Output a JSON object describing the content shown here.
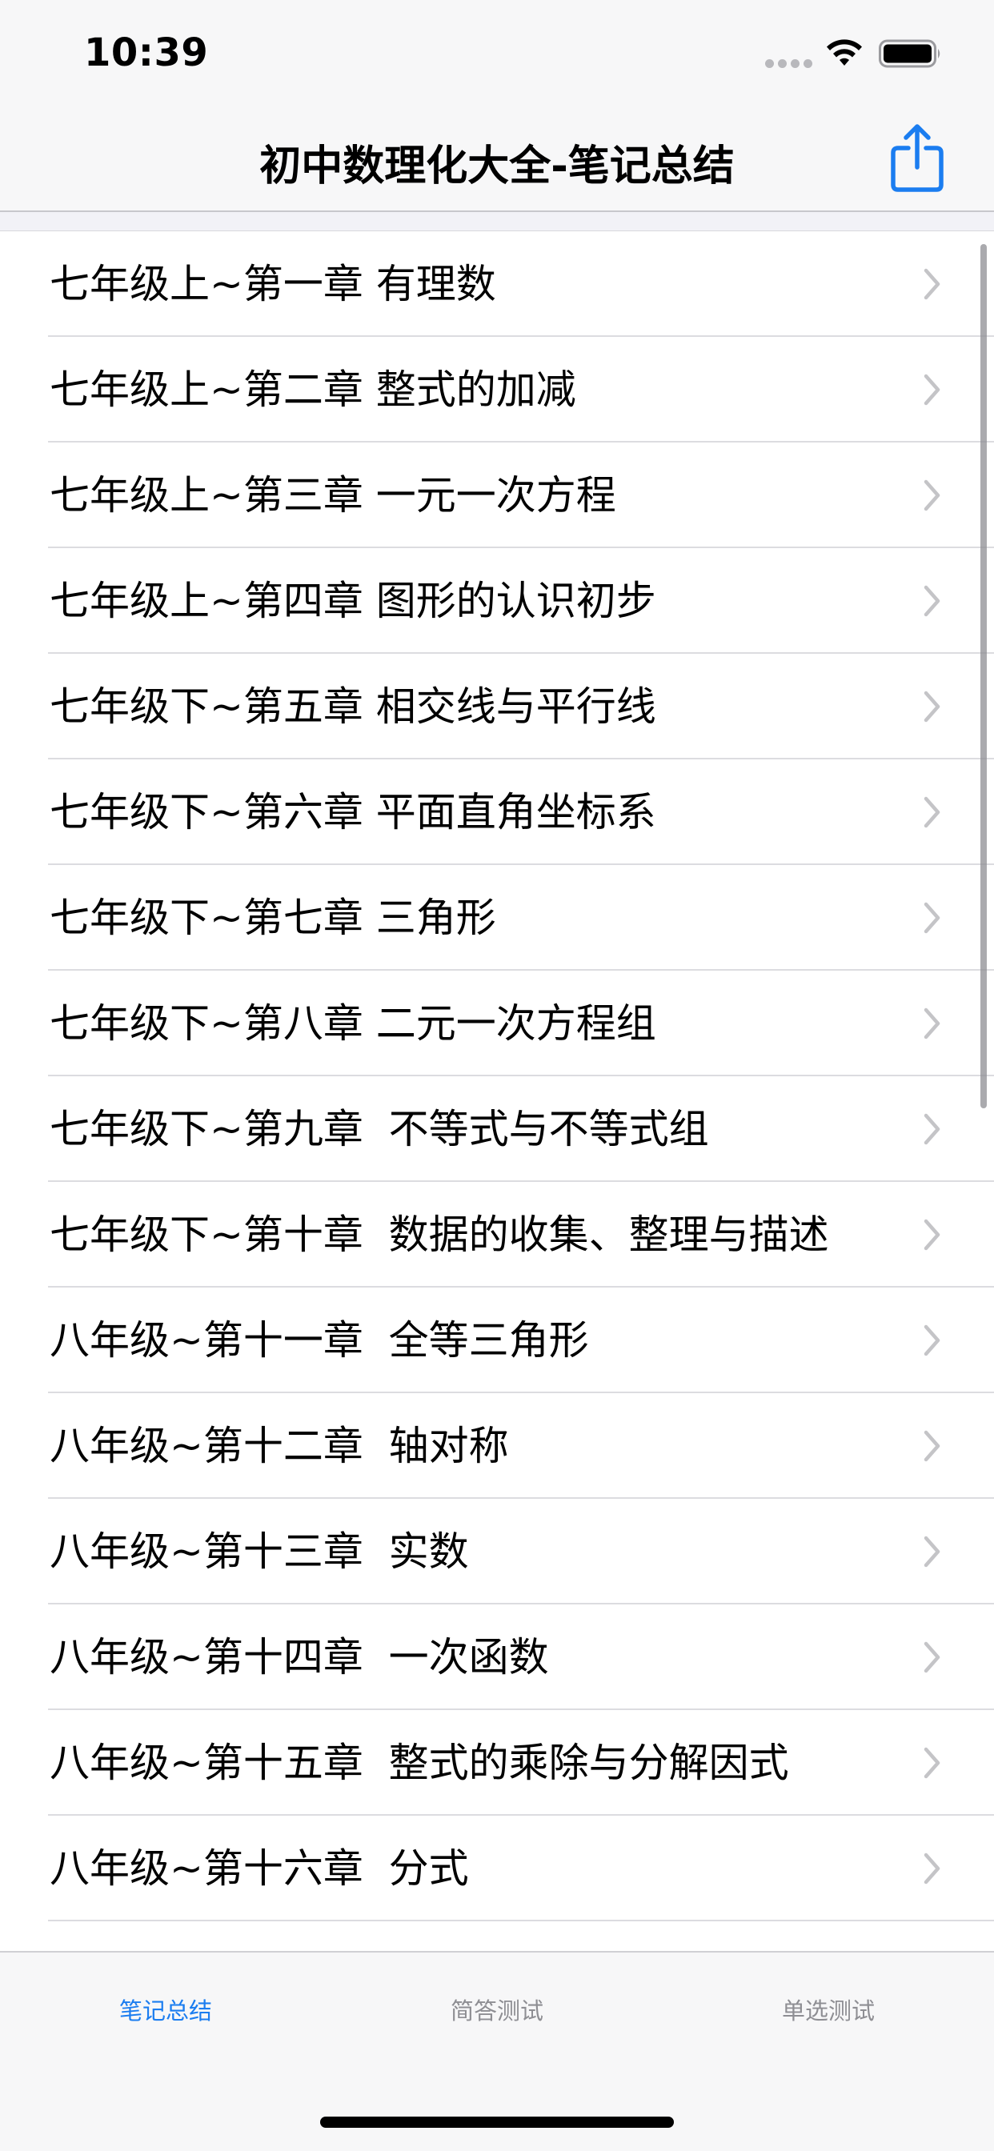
{
  "status": {
    "time": "10:39",
    "wifi_icon": "wifi-icon",
    "battery_icon": "battery-icon"
  },
  "nav": {
    "title": "初中数理化大全-笔记总结",
    "share_icon": "share-icon"
  },
  "list": {
    "items": [
      {
        "label": "七年级上~第一章 有理数"
      },
      {
        "label": "七年级上~第二章 整式的加减"
      },
      {
        "label": "七年级上~第三章 一元一次方程"
      },
      {
        "label": "七年级上~第四章 图形的认识初步"
      },
      {
        "label": "七年级下~第五章 相交线与平行线"
      },
      {
        "label": "七年级下~第六章 平面直角坐标系"
      },
      {
        "label": "七年级下~第七章 三角形"
      },
      {
        "label": "七年级下~第八章 二元一次方程组"
      },
      {
        "label": "七年级下~第九章  不等式与不等式组"
      },
      {
        "label": "七年级下~第十章  数据的收集、整理与描述"
      },
      {
        "label": "八年级~第十一章  全等三角形"
      },
      {
        "label": "八年级~第十二章  轴对称"
      },
      {
        "label": "八年级~第十三章  实数"
      },
      {
        "label": "八年级~第十四章  一次函数"
      },
      {
        "label": "八年级~第十五章  整式的乘除与分解因式"
      },
      {
        "label": "八年级~第十六章  分式"
      }
    ]
  },
  "tabs": [
    {
      "label": "笔记总结",
      "active": true
    },
    {
      "label": "简答测试",
      "active": false
    },
    {
      "label": "单选测试",
      "active": false
    }
  ],
  "colors": {
    "accent": "#1b7df0",
    "inactive_tab": "#8e8e93",
    "chevron": "#c4c4c7"
  }
}
